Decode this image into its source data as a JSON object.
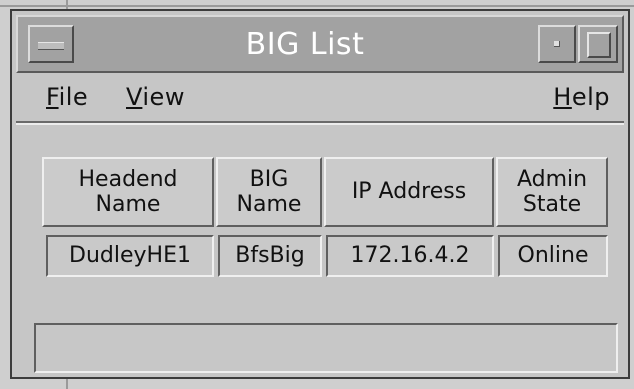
{
  "window": {
    "title": "BIG List"
  },
  "menubar": {
    "file": {
      "mnemonic": "F",
      "rest": "ile"
    },
    "view": {
      "mnemonic": "V",
      "rest": "iew"
    },
    "help": {
      "mnemonic": "H",
      "rest": "elp"
    }
  },
  "table": {
    "columns": [
      {
        "line1": "Headend",
        "line2": "Name"
      },
      {
        "line1": "BIG",
        "line2": "Name"
      },
      {
        "line1": "IP Address",
        "line2": ""
      },
      {
        "line1": "Admin",
        "line2": "State"
      }
    ],
    "rows": [
      {
        "headend_name": "DudleyHE1",
        "big_name": "BfsBig",
        "ip_address": "172.16.4.2",
        "admin_state": "Online"
      }
    ]
  },
  "status": {
    "text": ""
  },
  "colors": {
    "titlebar": "#a2a2a2",
    "window_bg": "#c6c6c6",
    "title_text": "#ffffff"
  }
}
